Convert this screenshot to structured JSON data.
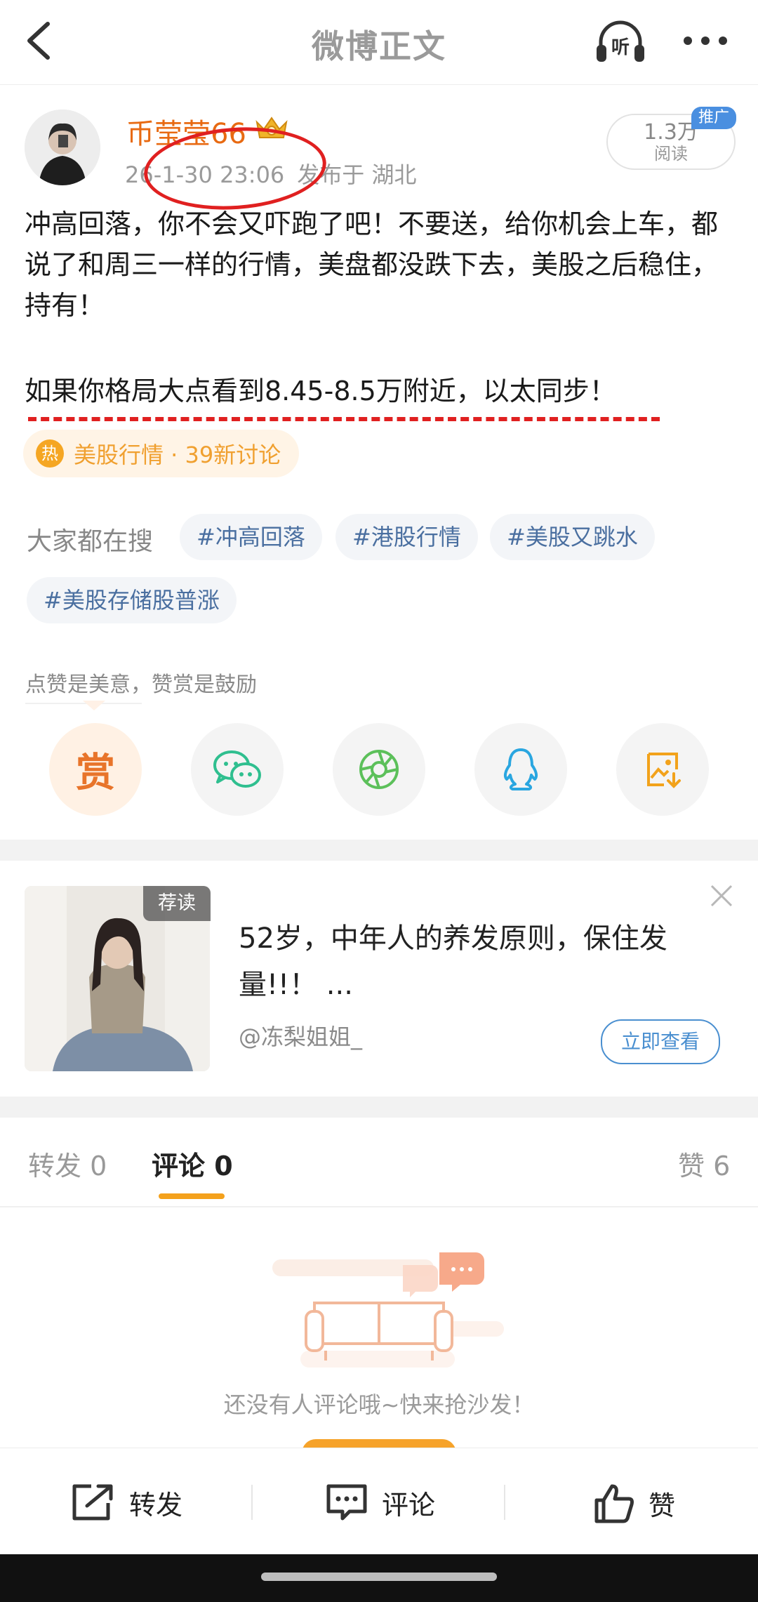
{
  "header": {
    "title": "微博正文",
    "listen_label": "听"
  },
  "author": {
    "name": "币莹莹66",
    "timestamp": "26-1-30 23:06",
    "location": "发布于 湖北",
    "reads_count": "1.3万",
    "reads_label": "阅读",
    "promo_badge": "推广"
  },
  "post": {
    "paragraph1": "冲高回落，你不会又吓跑了吧！不要送，给你机会上车，都说了和周三一样的行情，美盘都没跌下去，美股之后稳住，持有！",
    "paragraph2": "如果你格局大点看到8.45-8.5万附近，以太同步！"
  },
  "topic": {
    "hot_label": "热",
    "text": "美股行情 · 39新讨论"
  },
  "search": {
    "label": "大家都在搜",
    "tags": [
      "#冲高回落",
      "#港股行情",
      "#美股又跳水",
      "#美股存储股普涨"
    ]
  },
  "reward": {
    "hint": "点赞是美意，赞赏是鼓励",
    "reward_char": "赏"
  },
  "recommendation": {
    "badge": "荐读",
    "title": "52岁，中年人的养发原则，保住发量!!！ ...",
    "author": "@冻梨姐姐_",
    "button": "立即查看"
  },
  "tabs": {
    "repost": "转发 0",
    "comment": "评论 0",
    "like": "赞 6"
  },
  "empty_state": {
    "text": "还没有人评论哦~快来抢沙发！"
  },
  "bottom_bar": {
    "repost": "转发",
    "comment": "评论",
    "like": "赞"
  },
  "colors": {
    "username": "#e86a12",
    "accent": "#f4a11c",
    "link": "#4a6fa0",
    "annotation_red": "#e02020"
  }
}
